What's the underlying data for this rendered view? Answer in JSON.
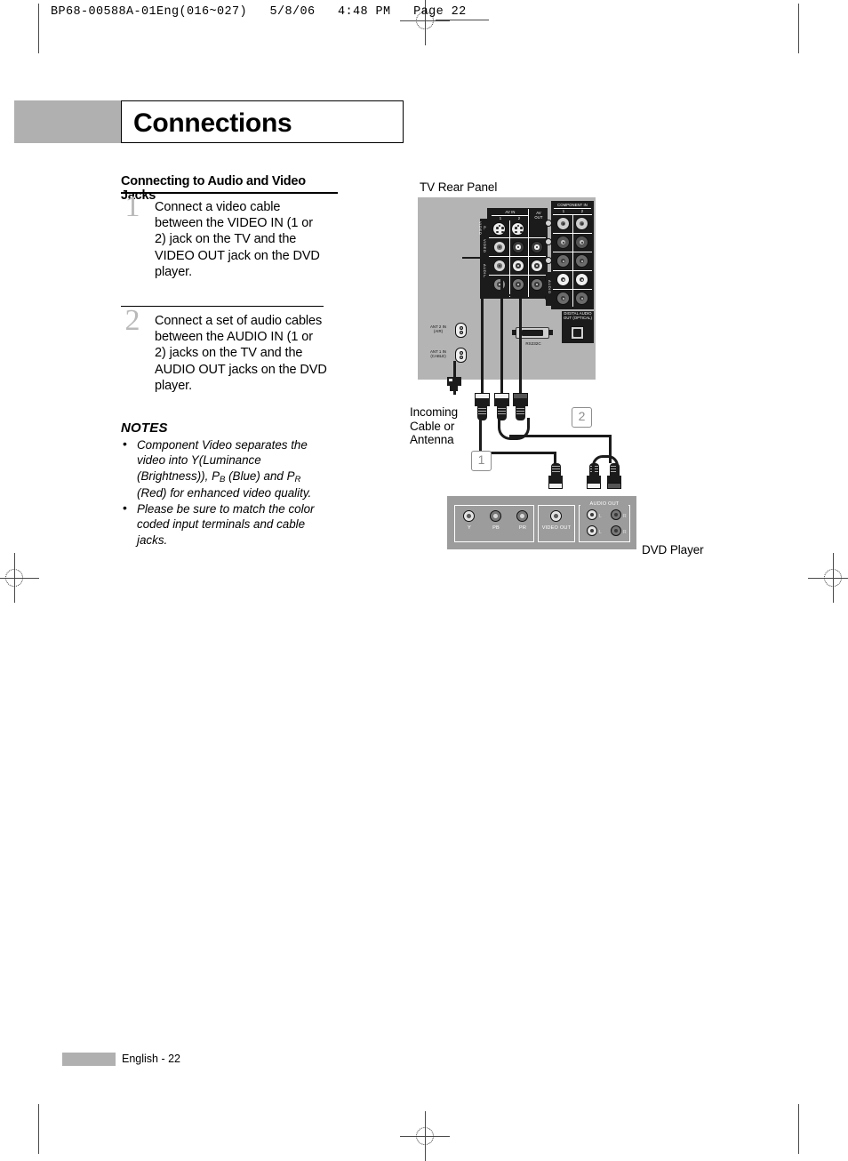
{
  "sheet": {
    "header": "BP68-00588A-01Eng(016~027)   5/8/06   4:48 PM   Page 22"
  },
  "chapter": {
    "title": "Connections"
  },
  "section": {
    "heading": "Connecting to Audio and Video Jacks"
  },
  "steps": [
    {
      "number": "1",
      "text": "Connect a video cable between the VIDEO IN (1 or 2) jack on the TV and the VIDEO OUT jack on the DVD player."
    },
    {
      "number": "2",
      "text": "Connect a set of audio cables between the AUDIO IN (1 or 2) jacks on the TV and the AUDIO OUT jacks on the DVD player."
    }
  ],
  "notes": {
    "title": "NOTES",
    "items": [
      {
        "part1": "Component Video separates the video into Y(Luminance (Brightness)), P",
        "sub1": "B",
        "part2": " (Blue) and P",
        "sub2": "R",
        "part3": " (Red) for enhanced video quality."
      },
      {
        "part1": "Please be sure to match the color coded input terminals and cable jacks.",
        "sub1": "",
        "part2": "",
        "sub2": "",
        "part3": ""
      }
    ]
  },
  "figure": {
    "tv_caption": "TV Rear Panel",
    "dvd_caption": "DVD Player",
    "antenna_caption_lines": [
      "Incoming",
      "Cable or",
      "Antenna"
    ],
    "callouts": [
      "1",
      "2"
    ],
    "tv_panel": {
      "av_in_title": "AV IN",
      "av_in_cols": [
        "1",
        "2"
      ],
      "av_out_title": "AV OUT",
      "side_labels": [
        "S-VIDEO",
        "VIDEO",
        "AUDIO"
      ],
      "component_title": "COMPONENT IN",
      "component_cols": [
        "1",
        "2"
      ],
      "component_rows": [
        "Y",
        "PB",
        "PR",
        "L",
        "R"
      ],
      "optical_label": "DIGITAL AUDIO OUT (OPTICAL)",
      "ant2": {
        "line1": "ANT 2 IN",
        "line2": "(AIR)"
      },
      "ant1": {
        "line1": "ANT 1 IN",
        "line2": "(CABLE)"
      },
      "serial_label": "RS232C"
    },
    "dvd_panel": {
      "component_labels": [
        "Y",
        "PB",
        "PR"
      ],
      "video_out_label": "VIDEO OUT",
      "audio_out_label": "AUDIO OUT",
      "audio_channels": [
        "L",
        "R",
        "L",
        "R"
      ]
    }
  },
  "footer": {
    "page_label": "English - 22"
  },
  "colors": {
    "band_gray": "#b0b0b0",
    "panel_gray": "#b4b4b4",
    "dvd_gray": "#9c9c9c",
    "step_number_gray": "#b9b9b9",
    "callout_gray": "#8d8d8d",
    "ink_black": "#000000"
  }
}
